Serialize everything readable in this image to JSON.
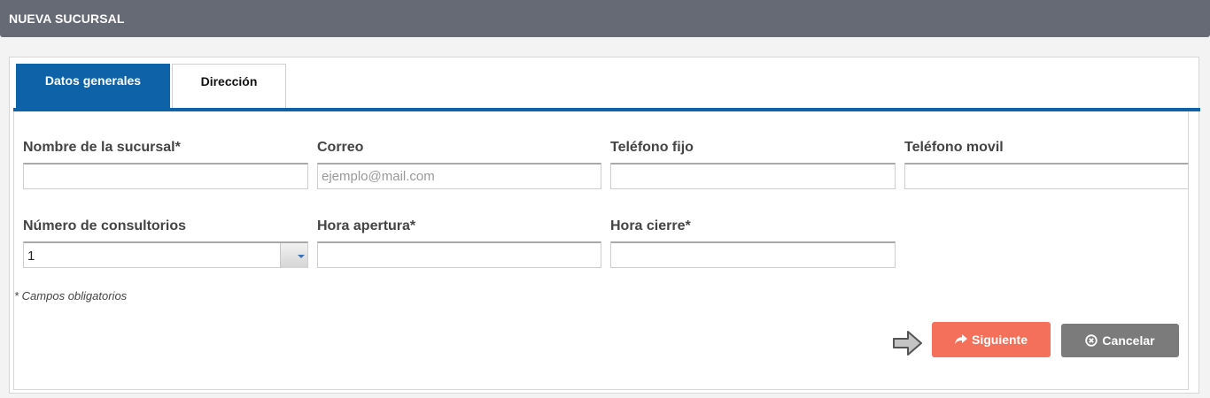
{
  "header": {
    "title": "NUEVA SUCURSAL"
  },
  "tabs": [
    {
      "label": "Datos generales",
      "active": true
    },
    {
      "label": "Dirección",
      "active": false
    }
  ],
  "form": {
    "nombre": {
      "label": "Nombre de la sucursal*",
      "value": "",
      "placeholder": ""
    },
    "correo": {
      "label": "Correo",
      "value": "",
      "placeholder": "ejemplo@mail.com"
    },
    "telefono_fijo": {
      "label": "Teléfono fijo",
      "value": "",
      "placeholder": ""
    },
    "telefono_movil": {
      "label": "Teléfono movil",
      "value": "",
      "placeholder": ""
    },
    "consultorios": {
      "label": "Número de consultorios",
      "selected": "1"
    },
    "hora_apertura": {
      "label": "Hora apertura*",
      "value": "",
      "placeholder": ""
    },
    "hora_cierre": {
      "label": "Hora cierre*",
      "value": "",
      "placeholder": ""
    }
  },
  "note": "* Campos obligatorios",
  "actions": {
    "next_label": "Siguiente",
    "next_icon": "share-arrow-icon",
    "cancel_label": "Cancelar",
    "cancel_icon": "circle-x-icon",
    "pointer_icon": "right-arrow-icon"
  },
  "colors": {
    "header_bg": "#666a75",
    "accent": "#0e62a8",
    "next_button": "#f4705a",
    "cancel_button": "#7b7b7b"
  }
}
